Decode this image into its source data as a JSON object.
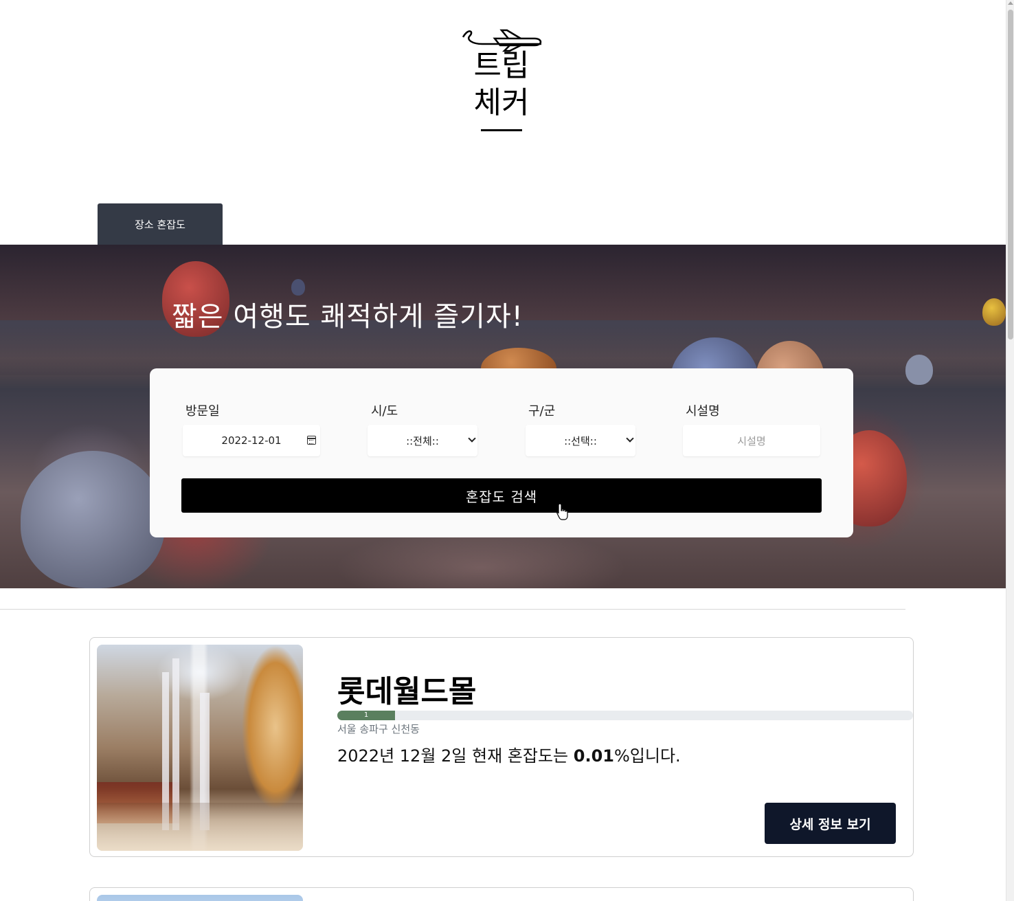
{
  "logo": {
    "line1": "트립",
    "line2": "체커"
  },
  "tabs": [
    {
      "label": "장소 혼잡도"
    }
  ],
  "hero": {
    "title": "짧은 여행도 쾌적하게 즐기자!"
  },
  "search": {
    "visit_date_label": "방문일",
    "visit_date_value": "2022-12-01",
    "city_label": "시/도",
    "city_value": "::전체::",
    "district_label": "구/군",
    "district_value": "::선택::",
    "facility_label": "시설명",
    "facility_placeholder": "시설명",
    "button_label": "혼잡도 검색"
  },
  "results": [
    {
      "name": "롯데월드몰",
      "congestion_bar_value": 1,
      "congestion_bar_label": "1",
      "address": "서울 송파구 신천동",
      "status_prefix": "2022년 12월 2일 현재 혼잡도는 ",
      "status_value": "0.01",
      "status_suffix": "%입니다.",
      "detail_button": "상세 정보 보기"
    }
  ],
  "colors": {
    "tab_bg": "#343a46",
    "search_button_bg": "#000000",
    "detail_button_bg": "#0f172a",
    "progress_fill": "#5a7f5e"
  },
  "icons": {
    "logo": "airplane-logo-icon",
    "date_picker": "calendar-icon",
    "select": "chevron-down-icon",
    "cursor": "hand-pointer-icon"
  }
}
